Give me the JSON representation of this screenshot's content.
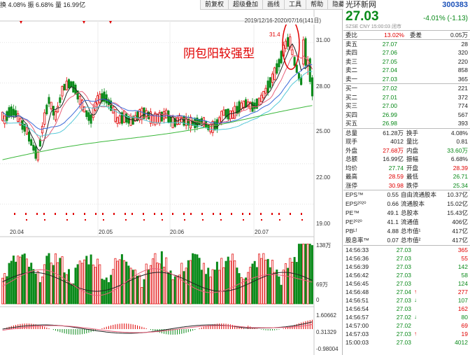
{
  "top_stats": "换 4.08%  振 6.68%  量 16.99亿",
  "toolbar": [
    "前复权",
    "超级叠加",
    "画线",
    "工具",
    "帮助",
    "隐藏"
  ],
  "range_label": "2019/12/16-2020/07/16(141日)",
  "annotation": "阴包阳较强型",
  "peak_label": "31.4",
  "y_labels": [
    "31.00",
    "28.00",
    "25.00",
    "22.00",
    "19.00"
  ],
  "x_labels": [
    "20.04",
    "20.05",
    "20.06",
    "20.07"
  ],
  "vol_labels": [
    "138万",
    "69万",
    "0"
  ],
  "macd_labels": [
    "1.60662",
    "0.31329",
    "-0.98004"
  ],
  "chart_data": {
    "type": "candlestick",
    "count": 141,
    "y_range": [
      17.0,
      32.6
    ],
    "series": [
      "K",
      "MA5",
      "MA10",
      "MA20",
      "MA60",
      "VOL",
      "MACD"
    ]
  },
  "quote": {
    "name": "光环新网",
    "code": "300383",
    "price": "27.03",
    "change": "-4.01% (-1.13)",
    "sub": "SZSE  CNY  15:00:03  闭市",
    "weibi_label": "委比",
    "weibi_val": "13.02%",
    "weicha_label": "委差",
    "weicha_val": "0.05万",
    "asks": [
      {
        "label": "卖五",
        "price": "27.07",
        "vol": "28"
      },
      {
        "label": "卖四",
        "price": "27.06",
        "vol": "320"
      },
      {
        "label": "卖三",
        "price": "27.05",
        "vol": "220"
      },
      {
        "label": "卖二",
        "price": "27.04",
        "vol": "858"
      },
      {
        "label": "卖一",
        "price": "27.03",
        "vol": "365"
      }
    ],
    "bids": [
      {
        "label": "买一",
        "price": "27.02",
        "vol": "221"
      },
      {
        "label": "买二",
        "price": "27.01",
        "vol": "372"
      },
      {
        "label": "买三",
        "price": "27.00",
        "vol": "774"
      },
      {
        "label": "买四",
        "price": "26.99",
        "vol": "567"
      },
      {
        "label": "买五",
        "price": "26.98",
        "vol": "393"
      }
    ],
    "stats": [
      {
        "l1": "总量",
        "v1": "61.28万",
        "c1": "blk",
        "l2": "换手",
        "v2": "4.08%",
        "c2": "blk"
      },
      {
        "l1": "现手",
        "v1": "4012",
        "c1": "blk",
        "l2": "量比",
        "v2": "0.81",
        "c2": "blk"
      },
      {
        "l1": "外盘",
        "v1": "27.68万",
        "c1": "red",
        "l2": "内盘",
        "v2": "33.60万",
        "c2": "green"
      },
      {
        "l1": "总额",
        "v1": "16.99亿",
        "c1": "blk",
        "l2": "振幅",
        "v2": "6.68%",
        "c2": "blk"
      },
      {
        "l1": "均价",
        "v1": "27.74",
        "c1": "green",
        "l2": "开盘",
        "v2": "28.39",
        "c2": "red"
      },
      {
        "l1": "最高",
        "v1": "28.59",
        "c1": "red",
        "l2": "最低",
        "v2": "26.71",
        "c2": "green"
      },
      {
        "l1": "涨停",
        "v1": "30.98",
        "c1": "red",
        "l2": "跌停",
        "v2": "25.34",
        "c2": "green"
      }
    ],
    "fundamentals": [
      {
        "l1": "EPS™",
        "v1": "0.55",
        "l2": "自由流通股本",
        "v2": "10.37亿"
      },
      {
        "l1": "EPS²⁰²⁰",
        "v1": "0.66",
        "l2": "流通股本",
        "v2": "15.02亿"
      },
      {
        "l1": "PE™",
        "v1": "49.1",
        "l2": "总股本",
        "v2": "15.43亿"
      },
      {
        "l1": "PE²⁰²⁰",
        "v1": "41.1",
        "l2": "流通值",
        "v2": "406亿"
      },
      {
        "l1": "PBᴸᶠ",
        "v1": "4.88",
        "l2": "总市值¹",
        "v2": "417亿"
      },
      {
        "l1": "股息率™",
        "v1": "0.07",
        "l2": "总市值²",
        "v2": "417亿"
      }
    ],
    "ticks": [
      {
        "t": "14:56:33",
        "p": "27.03",
        "a": "",
        "v": "365",
        "vc": "red"
      },
      {
        "t": "14:56:36",
        "p": "27.03",
        "a": "",
        "v": "55",
        "vc": "red"
      },
      {
        "t": "14:56:39",
        "p": "27.03",
        "a": "",
        "v": "142",
        "vc": "green"
      },
      {
        "t": "14:56:42",
        "p": "27.03",
        "a": "",
        "v": "58",
        "vc": "green"
      },
      {
        "t": "14:56:45",
        "p": "27.03",
        "a": "",
        "v": "124",
        "vc": "green"
      },
      {
        "t": "14:56:48",
        "p": "27.04",
        "a": "↑",
        "ac": "red",
        "v": "277",
        "vc": "red"
      },
      {
        "t": "14:56:51",
        "p": "27.03",
        "a": "↓",
        "ac": "green",
        "v": "107",
        "vc": "green"
      },
      {
        "t": "14:56:54",
        "p": "27.03",
        "a": "",
        "v": "162",
        "vc": "red"
      },
      {
        "t": "14:56:57",
        "p": "27.02",
        "a": "↓",
        "ac": "green",
        "v": "80",
        "vc": "green"
      },
      {
        "t": "14:57:00",
        "p": "27.02",
        "a": "",
        "v": "69",
        "vc": "red"
      },
      {
        "t": "14:57:03",
        "p": "27.03",
        "a": "↑",
        "ac": "red",
        "v": "19",
        "vc": "red"
      },
      {
        "t": "15:00:03",
        "p": "27.03",
        "a": "",
        "v": "4012",
        "vc": "green"
      }
    ]
  },
  "colors": {
    "up": "#e00000",
    "down": "#0a8a1a",
    "ma5": "#222222",
    "ma10": "#e8607a",
    "ma20": "#3a6ad8",
    "ma60": "#3cb83c"
  }
}
